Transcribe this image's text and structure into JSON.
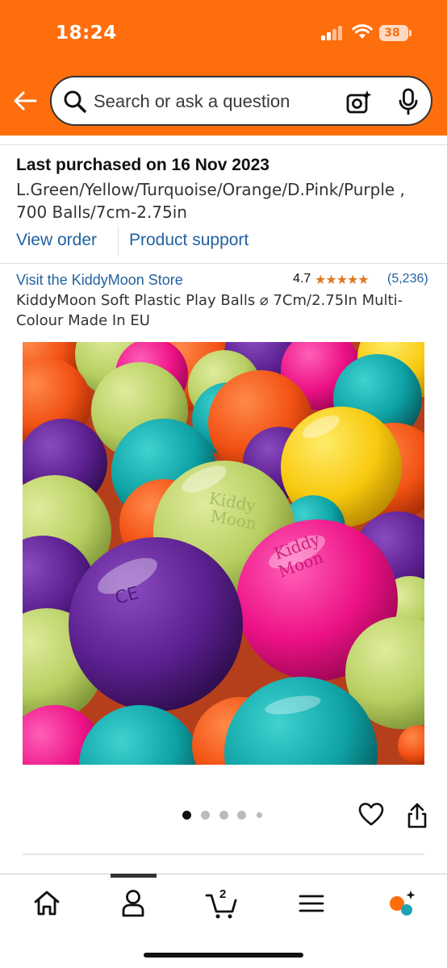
{
  "status": {
    "time": "18:24",
    "battery": "38"
  },
  "header": {
    "search_placeholder": "Search or ask a question",
    "icons": [
      "back-arrow-icon",
      "search-icon",
      "camera-lens-icon",
      "microphone-icon"
    ]
  },
  "purchase": {
    "last_purchased": "Last purchased on 16 Nov 2023",
    "variant": "L.Green/Yellow/Turquoise/Orange/D.Pink/Purple , 700 Balls/7cm-2.75in",
    "view_order": "View order",
    "product_support": "Product support"
  },
  "product": {
    "store_link": "Visit the KiddyMoon Store",
    "rating": "4.7",
    "stars_display": "★★★★★",
    "review_count": "(5,236)",
    "title": "KiddyMoon Soft Plastic Play Balls ⌀ 7Cm/2.75In Multi-Colour Made In EU",
    "image_count": 5,
    "active_image": 1
  },
  "bottom_nav": {
    "items": [
      "home-icon",
      "account-icon",
      "cart-icon",
      "menu-icon",
      "rufus-icon"
    ],
    "cart_count": "2",
    "accent": "#fe6e0c"
  },
  "colors": {
    "header_bg": "#fe6e0c",
    "link": "#2162a1",
    "star": "#de7921"
  }
}
